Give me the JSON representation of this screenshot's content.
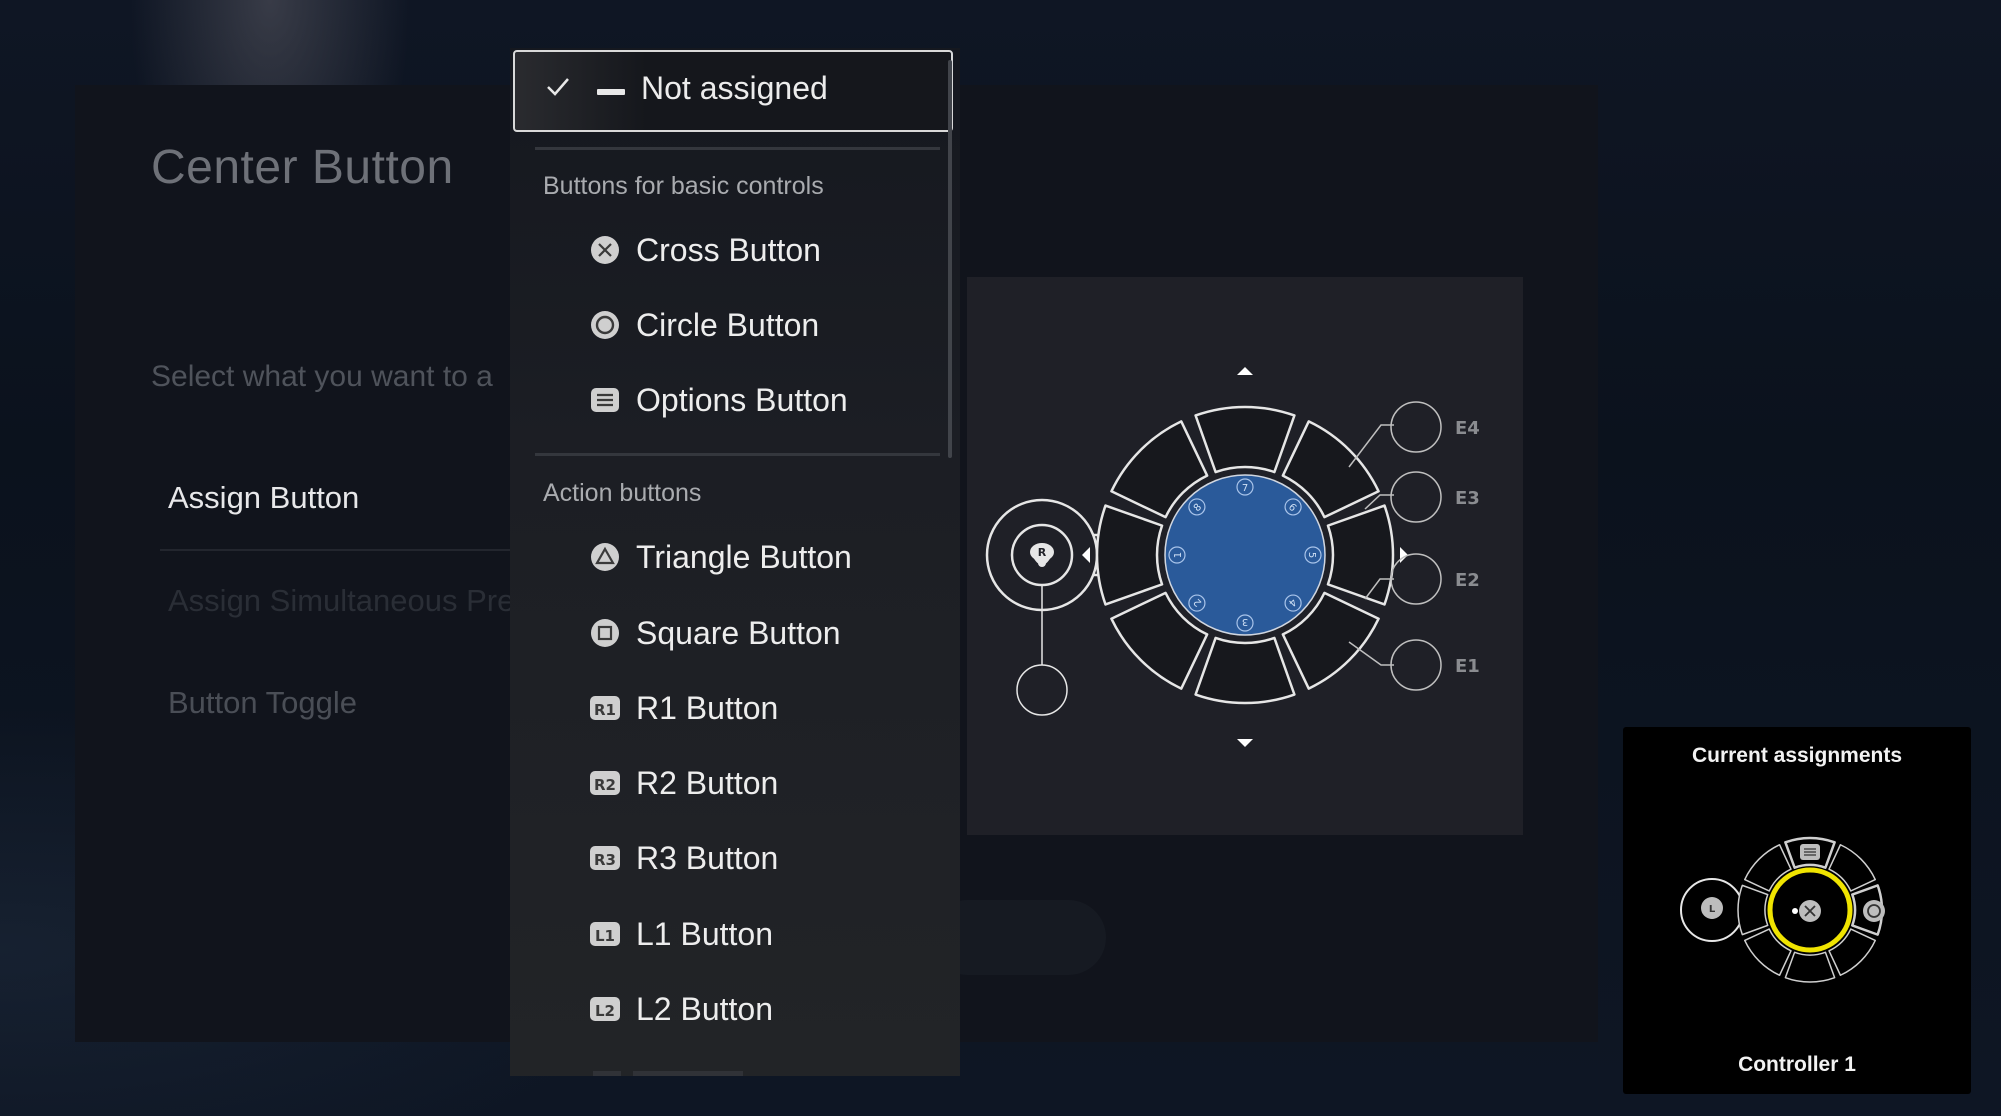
{
  "page": {
    "title": "Center Button",
    "subtitle": "Select what you want to a",
    "options": [
      {
        "label": "Assign Button",
        "state": "active"
      },
      {
        "label": "Assign Simultaneous Pre",
        "state": "disabled"
      },
      {
        "label": "Button Toggle",
        "state": "dim"
      }
    ]
  },
  "dropdown": {
    "selected": {
      "label": "Not assigned",
      "icon": "dash-icon",
      "checked": true
    },
    "sections": [
      {
        "header": "Buttons for basic controls",
        "items": [
          {
            "label": "Cross Button",
            "icon": "cross-icon"
          },
          {
            "label": "Circle Button",
            "icon": "circle-icon"
          },
          {
            "label": "Options Button",
            "icon": "options-icon"
          }
        ]
      },
      {
        "header": "Action buttons",
        "items": [
          {
            "label": "Triangle Button",
            "icon": "triangle-icon",
            "badge": ""
          },
          {
            "label": "Square Button",
            "icon": "square-icon",
            "badge": ""
          },
          {
            "label": "R1 Button",
            "icon": "r1-icon",
            "badge": "R1"
          },
          {
            "label": "R2 Button",
            "icon": "r2-icon",
            "badge": "R2"
          },
          {
            "label": "R3 Button",
            "icon": "r3-icon",
            "badge": "R3"
          },
          {
            "label": "L1 Button",
            "icon": "l1-icon",
            "badge": "L1"
          },
          {
            "label": "L2 Button",
            "icon": "l2-icon",
            "badge": "L2"
          }
        ]
      }
    ]
  },
  "diagram": {
    "stick_label": "R",
    "center_color": "#2a5a9a",
    "center_numbers": [
      "1",
      "2",
      "3",
      "4",
      "5",
      "6",
      "7",
      "8"
    ],
    "expansion_labels": [
      "E4",
      "E3",
      "E2",
      "E1"
    ]
  },
  "current_assignments": {
    "title": "Current assignments",
    "controller": "Controller 1",
    "stick_label": "L",
    "highlight_color": "#f0e400"
  }
}
